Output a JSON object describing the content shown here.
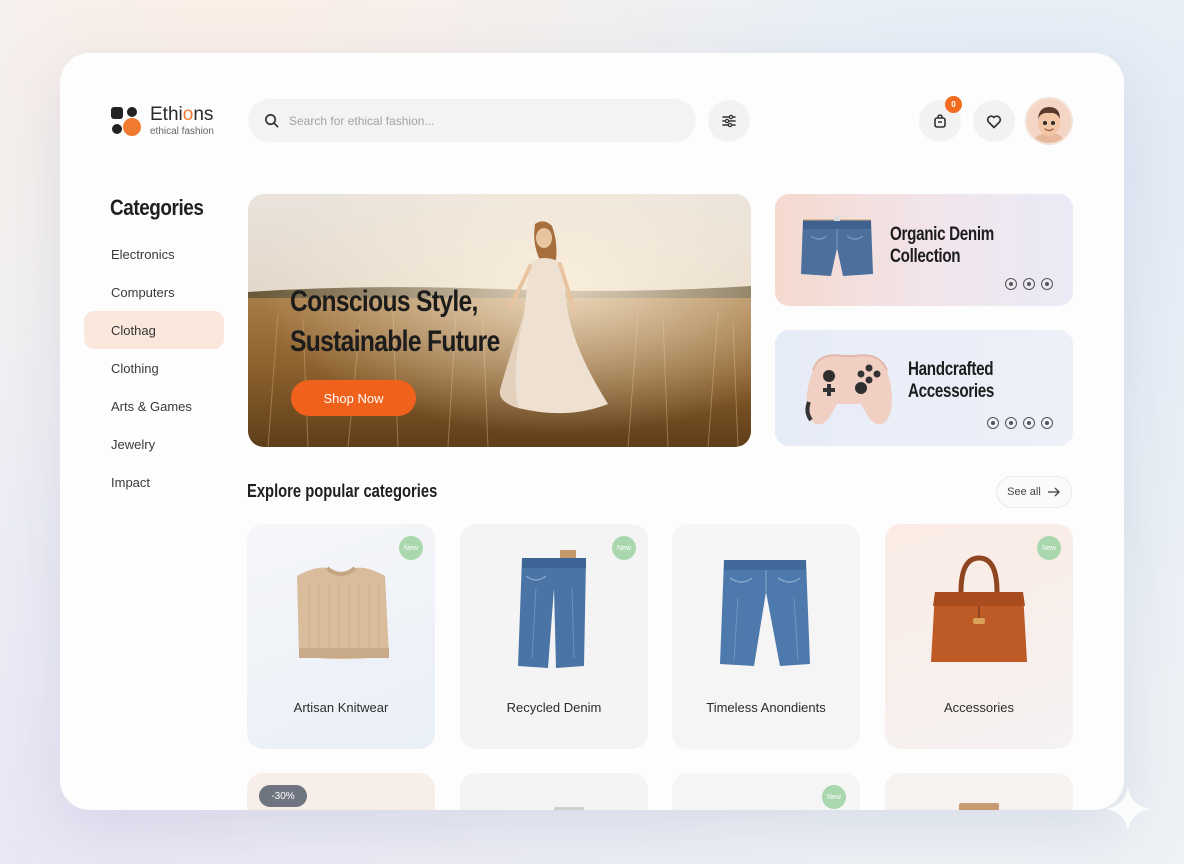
{
  "brand": {
    "name_prefix": "Ethi",
    "name_accent": "o",
    "name_suffix": "ns",
    "tagline": "ethical fashion"
  },
  "search": {
    "placeholder": "Search for ethical fashion..."
  },
  "header": {
    "cart_count": "0"
  },
  "sidebar": {
    "title": "Categories",
    "items": [
      {
        "label": "Electronics",
        "active": false
      },
      {
        "label": "Computers",
        "active": false
      },
      {
        "label": "Clothag",
        "active": true
      },
      {
        "label": "Clothing",
        "active": false
      },
      {
        "label": "Arts & Games",
        "active": false
      },
      {
        "label": "Jewelry",
        "active": false
      },
      {
        "label": "Impact",
        "active": false
      }
    ]
  },
  "hero": {
    "title_line1": "Conscious Style,",
    "title_line2": "Sustainable Future",
    "cta_label": "Shop Now"
  },
  "promos": [
    {
      "title_line1": "Organic Denim",
      "title_line2": "Collection"
    },
    {
      "title_line1": "Handcrafted",
      "title_line2": "Accessories"
    }
  ],
  "explore": {
    "title": "Explore popular categories",
    "see_all_label": "See all",
    "products": [
      {
        "name": "Artisan Knitwear",
        "tag": "New"
      },
      {
        "name": "Recycled Denim",
        "tag": "New"
      },
      {
        "name": "Timeless Anondients",
        "tag": ""
      },
      {
        "name": "Accessories",
        "tag": "New"
      }
    ],
    "second_row": [
      {
        "badge": "-30%"
      },
      {
        "badge": ""
      },
      {
        "badge": "New"
      },
      {
        "badge": ""
      }
    ]
  },
  "colors": {
    "accent": "#f0621c",
    "active_category_bg": "#fbe8dd",
    "tag_green": "#a9d7ae"
  }
}
